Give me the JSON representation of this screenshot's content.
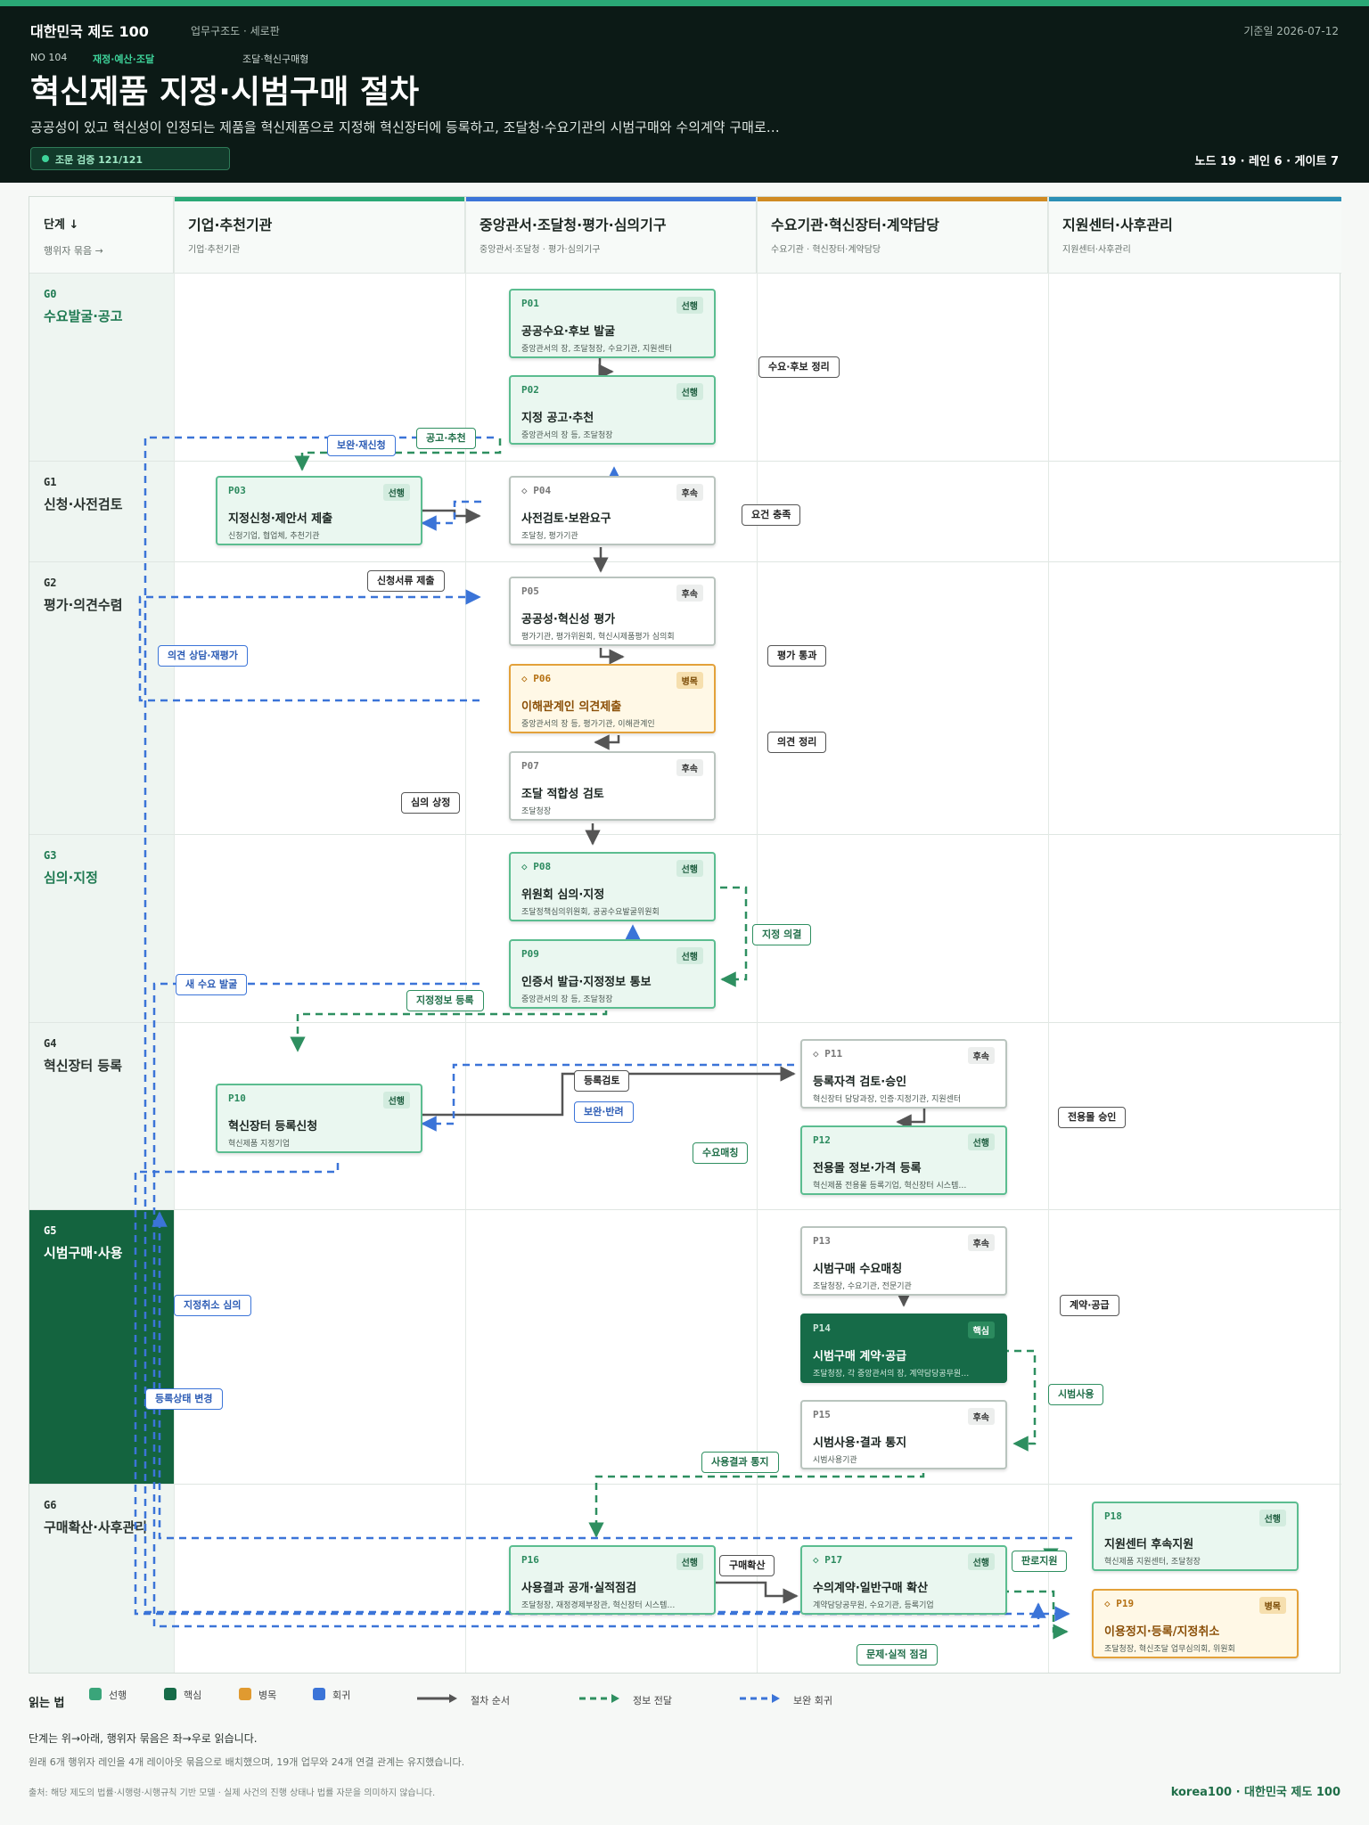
{
  "header": {
    "brand": "대한민국 제도 100",
    "category": "업무구조도 · 세로판",
    "date": "기준일 2026-07-12",
    "no": "NO 104",
    "tag": "재정·예산·조달",
    "type": "조달·혁신구매형",
    "title": "혁신제품 지정·시범구매 절차",
    "subtitle": "공공성이 있고 혁신성이 인정되는 제품을 혁신제품으로 지정해 혁신장터에 등록하고, 조달청·수요기관의 시범구매와 수의계약 구매로…",
    "verify_badge": "조문 검증 121/121",
    "stats": "노드 19 · 레인 6 · 게이트 7"
  },
  "corner": {
    "title": "단계 ↓",
    "sub": "행위자 묶음 →"
  },
  "lanes": [
    {
      "title": "기업·추천기관",
      "sub": "기업·추천기관",
      "color": "#2aa876"
    },
    {
      "title": "중앙관서·조달청·평가·심의기구",
      "sub": "중앙관서·조달청 · 평가·심의기구",
      "color": "#3b74d8"
    },
    {
      "title": "수요기관·혁신장터·계약담당",
      "sub": "수요기관 · 혁신장터·계약담당",
      "color": "#d08a22"
    },
    {
      "title": "지원센터·사후관리",
      "sub": "지원센터·사후관리",
      "color": "#2b8fb5"
    }
  ],
  "gates": [
    {
      "id": "G0",
      "name": "수요발굴·공고"
    },
    {
      "id": "G1",
      "name": "신청·사전검토"
    },
    {
      "id": "G2",
      "name": "평가·의견수렴"
    },
    {
      "id": "G3",
      "name": "심의·지정"
    },
    {
      "id": "G4",
      "name": "혁신장터 등록"
    },
    {
      "id": "G5",
      "name": "시범구매·사용"
    },
    {
      "id": "G6",
      "name": "구매확산·사후관리"
    }
  ],
  "nodes": [
    {
      "id": "P01",
      "kind": "선행",
      "title": "공공수요·후보 발굴",
      "sub": "중앙관서의 장, 조달청장, 수요기관, 지원센터"
    },
    {
      "id": "P02",
      "kind": "선행",
      "title": "지정 공고·추천",
      "sub": "중앙관서의 장 등, 조달청장"
    },
    {
      "id": "P03",
      "kind": "선행",
      "title": "지정신청·제안서 제출",
      "sub": "신청기업, 협업체, 추천기관"
    },
    {
      "id": "◇ P04",
      "kind": "후속",
      "title": "사전검토·보완요구",
      "sub": "조달청, 평가기관"
    },
    {
      "id": "P05",
      "kind": "후속",
      "title": "공공성·혁신성 평가",
      "sub": "평가기관, 평가위원회, 혁신시제품평가 심의회"
    },
    {
      "id": "◇ P06",
      "kind": "병목",
      "title": "이해관계인 의견제출",
      "sub": "중앙관서의 장 등, 평가기관, 이해관계인"
    },
    {
      "id": "P07",
      "kind": "후속",
      "title": "조달 적합성 검토",
      "sub": "조달청장"
    },
    {
      "id": "◇ P08",
      "kind": "선행",
      "title": "위원회 심의·지정",
      "sub": "조달정책심의위원회, 공공수요발굴위원회"
    },
    {
      "id": "P09",
      "kind": "선행",
      "title": "인증서 발급·지정정보 통보",
      "sub": "중앙관서의 장 등, 조달청장"
    },
    {
      "id": "P10",
      "kind": "선행",
      "title": "혁신장터 등록신청",
      "sub": "혁신제품 지정기업"
    },
    {
      "id": "◇ P11",
      "kind": "후속",
      "title": "등록자격 검토·승인",
      "sub": "혁신장터 담당과장, 인증·지정기관, 지원센터"
    },
    {
      "id": "P12",
      "kind": "선행",
      "title": "전용몰 정보·가격 등록",
      "sub": "혁신제품 전용몰 등록기업, 혁신장터 시스템…"
    },
    {
      "id": "P13",
      "kind": "후속",
      "title": "시범구매 수요매칭",
      "sub": "조달청장, 수요기관, 전문기관"
    },
    {
      "id": "P14",
      "kind": "핵심",
      "title": "시범구매 계약·공급",
      "sub": "조달청장, 각 중앙관서의 장, 계약담당공무원…"
    },
    {
      "id": "P15",
      "kind": "후속",
      "title": "시범사용·결과 통지",
      "sub": "시범사용기관"
    },
    {
      "id": "P16",
      "kind": "선행",
      "title": "사용결과 공개·실적점검",
      "sub": "조달청장, 재정경제부장관, 혁신장터 시스템…"
    },
    {
      "id": "◇ P17",
      "kind": "선행",
      "title": "수의계약·일반구매 확산",
      "sub": "계약담당공무원, 수요기관, 등록기업"
    },
    {
      "id": "P18",
      "kind": "선행",
      "title": "지원센터 후속지원",
      "sub": "혁신제품 지원센터, 조달청장"
    },
    {
      "id": "◇ P19",
      "kind": "병목",
      "title": "이용정지·등록/지정취소",
      "sub": "조달청장, 혁신조달 업무심의회, 위원회"
    }
  ],
  "edge_labels": [
    "수요·후보 정리",
    "공고·추천",
    "보완·재신청",
    "요건 충족",
    "신청서류 제출",
    "의견 상담·재평가",
    "평가 통과",
    "의견 정리",
    "심의 상정",
    "지정 의결",
    "새 수요 발굴",
    "지정정보 등록",
    "등록검토",
    "보완·반려",
    "수요매칭",
    "전용몰 승인",
    "지정취소 심의",
    "계약·공급",
    "등록상태 변경",
    "시범사용",
    "사용결과 통지",
    "구매확산",
    "판로지원",
    "문제·실적 점검"
  ],
  "legend": {
    "title": "읽는 법",
    "items": [
      {
        "label": "선행",
        "color": "#3aa57a"
      },
      {
        "label": "핵심",
        "color": "#166b48"
      },
      {
        "label": "병목",
        "color": "#e09a30"
      },
      {
        "label": "회귀",
        "color": "#3b74d8"
      }
    ],
    "lines": [
      "절차 순서",
      "정보 전달",
      "보완 회귀"
    ]
  },
  "notes": {
    "line1": "단계는 위→아래, 행위자 묶음은 좌→우로 읽습니다.",
    "line2": "원래 6개 행위자 레인을 4개 레이아웃 묶음으로 배치했으며, 19개 업무와 24개 연결 관계는 유지했습니다."
  },
  "footer": {
    "source": "출처: 해당 제도의 법률·시행령·시행규칙 기반 모델 · 실제 사건의 진행 상태나 법률 자문을 의미하지 않습니다.",
    "brand": "korea100 · 대한민국 제도 100"
  }
}
